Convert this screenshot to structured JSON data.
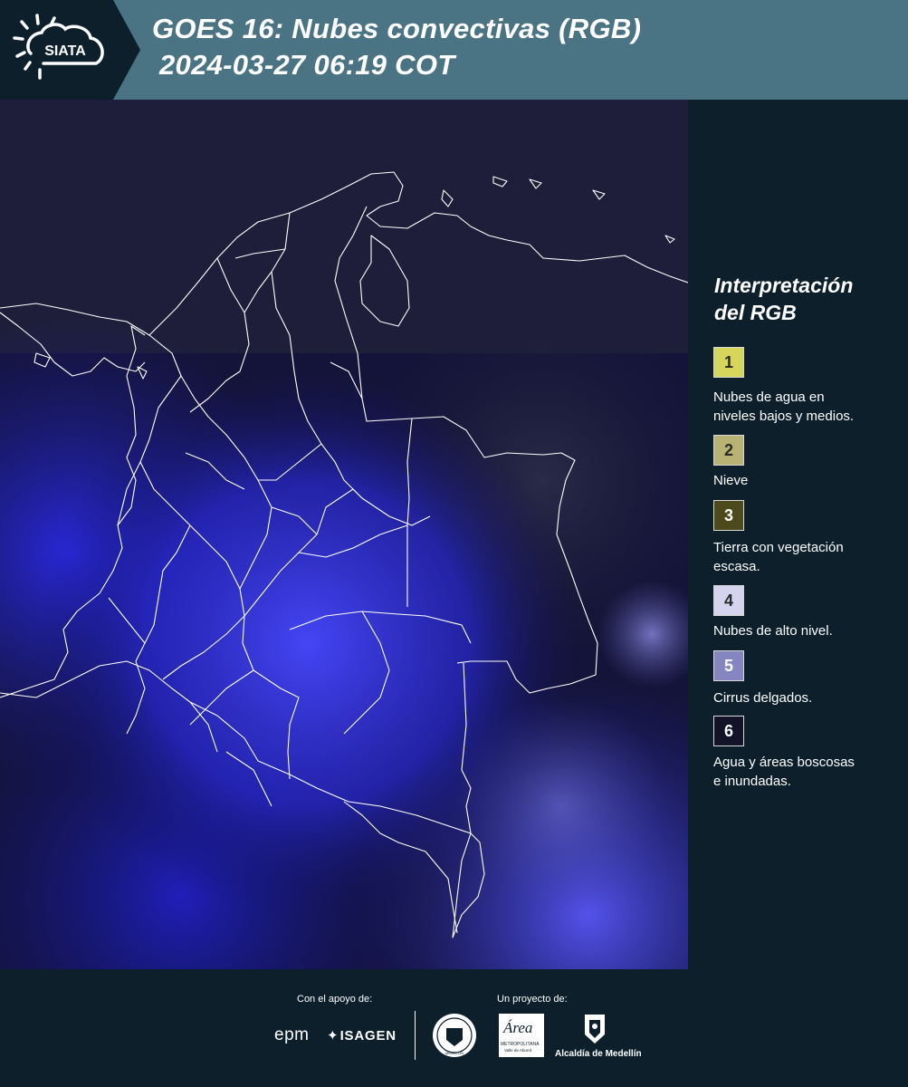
{
  "header": {
    "logo_text": "SIATA",
    "title_line1": "GOES 16: Nubes convectivas (RGB)",
    "title_line2": "2024-03-27 06:19 COT"
  },
  "legend": {
    "title_line1": "Interpretación",
    "title_line2": "del RGB",
    "items": [
      {
        "number": "1",
        "color": "#d6d65a",
        "label_lines": [
          "Nubes de agua en",
          "niveles bajos y medios."
        ]
      },
      {
        "number": "2",
        "color": "#b8b372",
        "label_lines": [
          "Nieve"
        ]
      },
      {
        "number": "3",
        "color": "#4c4a1c",
        "label_lines": [
          "Tierra con vegetación",
          "escasa."
        ]
      },
      {
        "number": "4",
        "color": "#d4d4ee",
        "label_lines": [
          "Nubes de alto nivel."
        ]
      },
      {
        "number": "5",
        "color": "#8585c2",
        "label_lines": [
          "Cirrus delgados."
        ]
      },
      {
        "number": "6",
        "color": "#121228",
        "label_lines": [
          "Agua y áreas boscosas",
          "e inundadas."
        ]
      }
    ]
  },
  "footer": {
    "support_label": "Con el apoyo de:",
    "project_label": "Un proyecto de:",
    "sponsors": [
      "epm",
      "ISAGEN"
    ],
    "partners": [
      "MEDELLÍN",
      "Área",
      "METROPOLITANA",
      "Valle de Aburrá",
      "Alcaldía de Medellín"
    ]
  }
}
